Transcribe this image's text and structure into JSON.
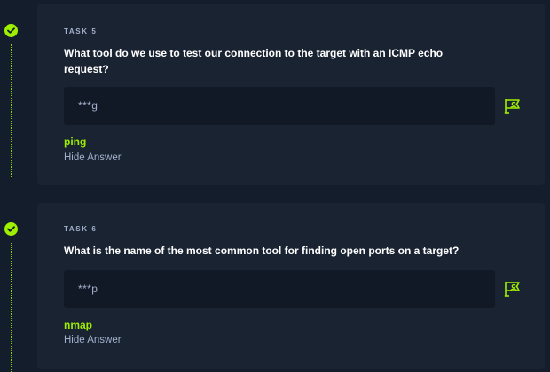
{
  "colors": {
    "background": "#141d2b",
    "card": "#1a2332",
    "accent": "#9fef00",
    "muted_text": "#a4b1cd",
    "answer_box": "#111927"
  },
  "tasks": [
    {
      "label": "TASK 5",
      "question": "What tool do we use to test our connection to the target with an ICMP echo request?",
      "masked_answer": "***g",
      "answer": "ping",
      "hide_label": "Hide Answer",
      "status_icon": "check-icon",
      "hint_icon": "flag-icon"
    },
    {
      "label": "TASK 6",
      "question": "What is the name of the most common tool for finding open ports on a target?",
      "masked_answer": "***p",
      "answer": "nmap",
      "hide_label": "Hide Answer",
      "status_icon": "check-icon",
      "hint_icon": "flag-icon"
    }
  ]
}
